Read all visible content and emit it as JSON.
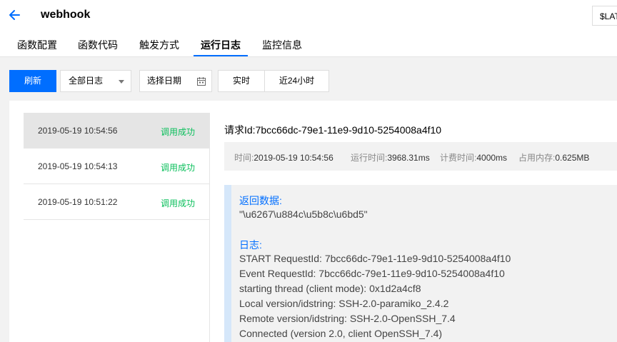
{
  "header": {
    "title": "webhook",
    "version_select": "$LATEST",
    "accent": "#006eff"
  },
  "tabs": [
    {
      "label": "函数配置",
      "active": false
    },
    {
      "label": "函数代码",
      "active": false
    },
    {
      "label": "触发方式",
      "active": false
    },
    {
      "label": "运行日志",
      "active": true
    },
    {
      "label": "监控信息",
      "active": false
    }
  ],
  "toolbar": {
    "refresh_label": "刷新",
    "log_filter": "全部日志",
    "date_placeholder": "选择日期",
    "realtime_label": "实时",
    "last24_label": "近24小时"
  },
  "log_list": [
    {
      "time": "2019-05-19 10:54:56",
      "status": "调用成功",
      "selected": true
    },
    {
      "time": "2019-05-19 10:54:13",
      "status": "调用成功",
      "selected": false
    },
    {
      "time": "2019-05-19 10:51:22",
      "status": "调用成功",
      "selected": false
    }
  ],
  "detail": {
    "request_id_label": "请求Id:",
    "request_id": "7bcc66dc-79e1-11e9-9d10-5254008a4f10",
    "meta": {
      "time_label": "时间:",
      "time": "2019-05-19 10:54:56",
      "run_label": "运行时间:",
      "run": "3968.31ms",
      "billed_label": "计费时间:",
      "billed": "4000ms",
      "memory_label": "占用内存:",
      "memory": "0.625MB"
    },
    "return_label": "返回数据:",
    "return_value": "\"\\u6267\\u884c\\u5b8c\\u6bd5\"",
    "log_label": "日志:",
    "log_lines": [
      "START RequestId: 7bcc66dc-79e1-11e9-9d10-5254008a4f10",
      "Event RequestId: 7bcc66dc-79e1-11e9-9d10-5254008a4f10",
      "starting thread (client mode): 0x1d2a4cf8",
      "Local version/idstring: SSH-2.0-paramiko_2.4.2",
      "Remote version/idstring: SSH-2.0-OpenSSH_7.4",
      "Connected (version 2.0, client OpenSSH_7.4)"
    ]
  }
}
